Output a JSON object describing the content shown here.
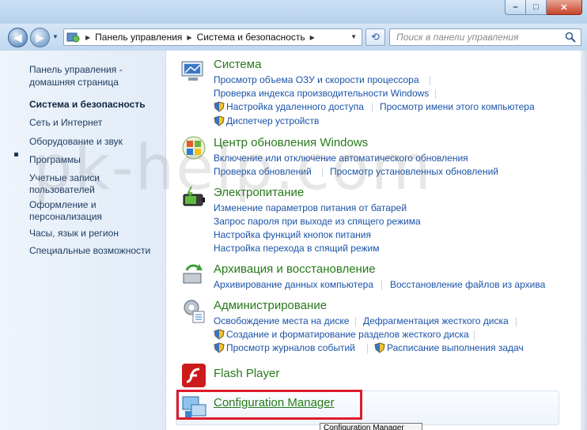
{
  "window": {
    "buttons": {
      "minimize": "–",
      "maximize": "□",
      "close": "✕"
    }
  },
  "navigation": {
    "back_icon": "back-arrow-icon",
    "forward_icon": "forward-arrow-icon",
    "breadcrumbs": [
      "Панель управления",
      "Система и безопасность"
    ],
    "refresh_icon": "refresh-icon",
    "search_placeholder": "Поиск в панели управления"
  },
  "sidebar": {
    "items": [
      {
        "label": "Панель управления -"
      },
      {
        "label": "домашняя страница"
      },
      {
        "label": "Система и безопасность"
      },
      {
        "label": "Сеть и Интернет"
      },
      {
        "label": "Оборудование и звук"
      },
      {
        "label": "Программы"
      },
      {
        "label": "Учетные записи"
      },
      {
        "label": "пользователей"
      },
      {
        "label": "Оформление и"
      },
      {
        "label": "персонализация"
      },
      {
        "label": "Часы, язык и регион"
      },
      {
        "label": "Специальные возможности"
      }
    ]
  },
  "categories": {
    "system": {
      "title": "Система",
      "links": [
        "Просмотр объема ОЗУ и скорости процессора",
        "Проверка индекса производительности Windows",
        "Настройка удаленного доступа",
        "Просмотр имени этого компьютера",
        "Диспетчер устройств"
      ]
    },
    "update": {
      "title": "Центр обновления Windows",
      "links": [
        "Включение или отключение автоматического обновления",
        "Проверка обновлений",
        "Просмотр установленных обновлений"
      ]
    },
    "power": {
      "title": "Электропитание",
      "links": [
        "Изменение параметров питания от батарей",
        "Запрос пароля при выходе из спящего режима",
        "Настройка функций кнопок питания",
        "Настройка перехода в спящий режим"
      ]
    },
    "backup": {
      "title": "Архивация и восстановление",
      "links": [
        "Архивирование данных компьютера",
        "Восстановление файлов из архива"
      ]
    },
    "admin": {
      "title": "Администрирование",
      "links": [
        "Освобождение места на диске",
        "Дефрагментация жесткого диска",
        "Создание и форматирование разделов жесткого диска",
        "Просмотр журналов событий",
        "Расписание выполнения задач"
      ]
    },
    "flash": {
      "title": "Flash Player"
    },
    "config": {
      "title": "Configuration Manager"
    }
  },
  "tooltip": "Configuration Manager",
  "watermark": "pk-help.com",
  "colors": {
    "category_title": "#267a1a",
    "link": "#1a53a8",
    "highlight": "#e01b2c"
  }
}
